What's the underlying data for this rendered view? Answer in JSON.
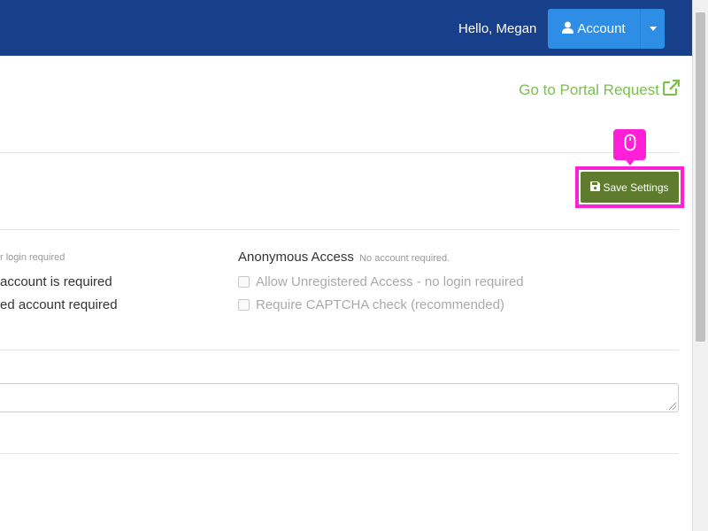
{
  "navbar": {
    "greeting": "Hello, Megan",
    "account_label": "Account",
    "brand_color": "#173f8a",
    "button_color": "#2e8ee6"
  },
  "portal": {
    "link_label": "Go to Portal Request",
    "link_color": "#7bbf4e"
  },
  "toolbar": {
    "save_label": "Save Settings",
    "save_color": "#5e7b2e"
  },
  "registered_access": {
    "note": "r login required",
    "option_1": "account is required",
    "option_2": "ed account required"
  },
  "anonymous_access": {
    "title": "Anonymous Access",
    "note": "No account required.",
    "options": [
      {
        "label": "Allow Unregistered Access - no login required",
        "checked": false
      },
      {
        "label": "Require CAPTCHA check (recommended)",
        "checked": false
      }
    ]
  },
  "textarea": {
    "value": ""
  },
  "highlight_color": "#ff1fd6"
}
